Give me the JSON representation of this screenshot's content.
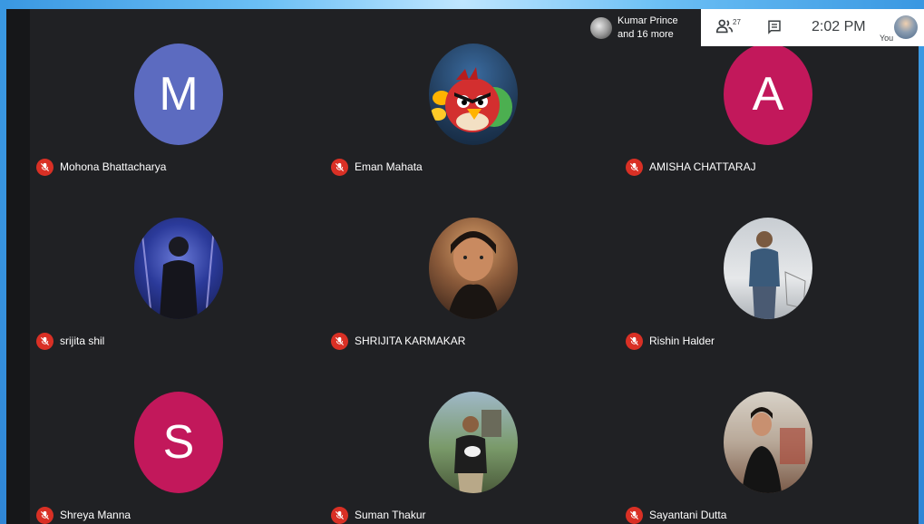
{
  "topbar": {
    "presenter_line1": "Kumar Prince",
    "presenter_line2": "and 16 more",
    "participants_count": "27",
    "time": "2:02 PM",
    "you_label": "You"
  },
  "participants": [
    {
      "name": "Mohona Bhattacharya",
      "avatar_type": "letter",
      "letter": "M",
      "color": "#5c6bc0"
    },
    {
      "name": "Eman Mahata",
      "avatar_type": "photo",
      "icon": "angry-bird-avatar"
    },
    {
      "name": "AMISHA CHATTARAJ",
      "avatar_type": "letter",
      "letter": "A",
      "color": "#c2185b"
    },
    {
      "name": "srijita shil",
      "avatar_type": "photo",
      "icon": "person-photo-avatar"
    },
    {
      "name": "SHRIJITA KARMAKAR",
      "avatar_type": "photo",
      "icon": "person-photo-avatar"
    },
    {
      "name": "Rishin Halder",
      "avatar_type": "photo",
      "icon": "person-photo-avatar"
    },
    {
      "name": "Shreya Manna",
      "avatar_type": "letter",
      "letter": "S",
      "color": "#c2185b"
    },
    {
      "name": "Suman Thakur",
      "avatar_type": "photo",
      "icon": "person-photo-avatar"
    },
    {
      "name": "Sayantani Dutta",
      "avatar_type": "photo",
      "icon": "person-photo-avatar"
    }
  ],
  "colors": {
    "stage": "#202124",
    "mic_muted": "#d93025"
  }
}
